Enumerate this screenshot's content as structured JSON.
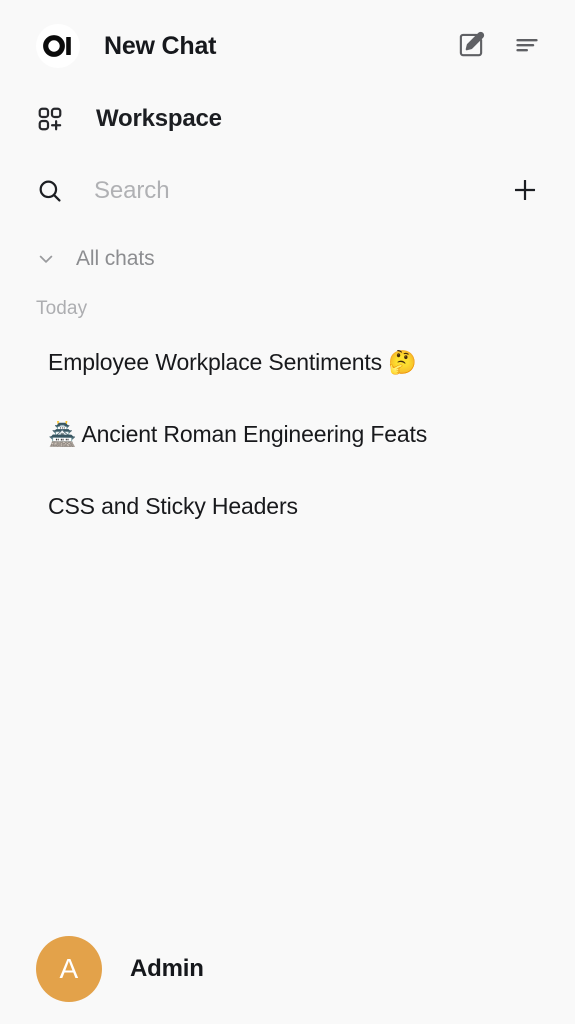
{
  "theme": {
    "background": "#f9f9f9",
    "text_primary": "#18191c",
    "text_muted": "#8c8d90",
    "placeholder": "#b0b1b4",
    "avatar_accent": "#e3a24a",
    "icon_stroke": "#5f6064"
  },
  "header": {
    "logo_text": "OI",
    "logo_icon": "open-webui-logo",
    "title": "New Chat",
    "new_chat_icon": "pencil-square-icon",
    "collapse_icon": "sidebar-toggle-icon"
  },
  "workspace": {
    "label": "Workspace",
    "icon": "workspace-grid-plus-icon"
  },
  "search": {
    "icon": "search-icon",
    "placeholder": "Search",
    "value": "",
    "add_icon": "plus-icon"
  },
  "all_chats": {
    "label": "All chats",
    "chevron_icon": "chevron-down-icon",
    "expanded": true
  },
  "chat_groups": [
    {
      "label": "Today",
      "items": [
        {
          "title": "Employee Workplace Sentiments 🤔"
        },
        {
          "title": "🏯 Ancient Roman Engineering Feats"
        },
        {
          "title": "CSS and Sticky Headers"
        }
      ]
    }
  ],
  "footer": {
    "avatar_initial": "A",
    "name": "Admin"
  }
}
